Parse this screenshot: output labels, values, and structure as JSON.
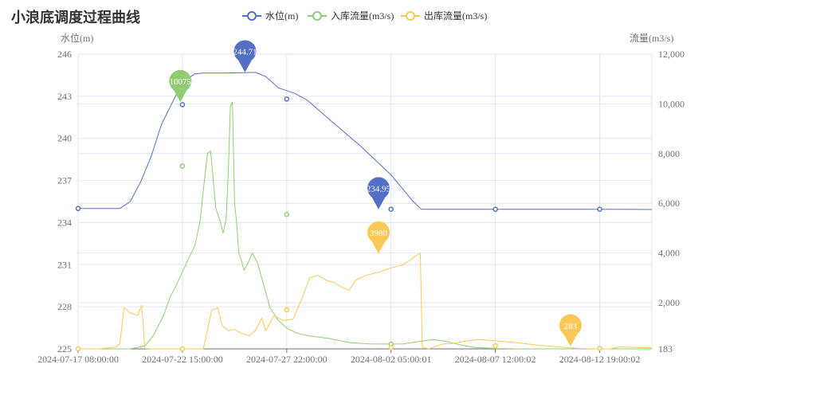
{
  "title": "小浪底调度过程曲线",
  "chart_data": {
    "type": "line",
    "title": "小浪底调度过程曲线",
    "y_left_label": "水位(m)",
    "y_right_label": "流量(m3/s)",
    "x_ticks": [
      "2024-07-17 08:00:00",
      "2024-07-22 15:00:00",
      "2024-07-27 22:00:00",
      "2024-08-02 05:00:01",
      "2024-08-07 12:00:02",
      "2024-08-12 19:00:02"
    ],
    "y_left": {
      "min": 225,
      "max": 246,
      "ticks": [
        225,
        228,
        231,
        234,
        237,
        240,
        243,
        246
      ]
    },
    "y_right": {
      "ticks": [
        183,
        2000,
        4000,
        6000,
        8000,
        10000,
        12000
      ],
      "tick_labels": [
        "183",
        "2,000",
        "4,000",
        "6,000",
        "8,000",
        "10,000",
        "12,000"
      ]
    },
    "legend_position": "top-center",
    "grid": true,
    "series": [
      {
        "name": "水位(m)",
        "axis": "left",
        "color": "#5470c6",
        "points": [
          [
            0,
            235
          ],
          [
            1,
            235
          ],
          [
            2,
            235
          ],
          [
            2.5,
            235.5
          ],
          [
            3,
            236.9
          ],
          [
            3.5,
            238.7
          ],
          [
            4,
            241
          ],
          [
            4.6,
            242.8
          ],
          [
            5,
            244
          ],
          [
            5.6,
            244.6
          ],
          [
            6,
            244.65
          ],
          [
            7,
            244.65
          ],
          [
            8.5,
            244.7
          ],
          [
            9,
            244.4
          ],
          [
            9.6,
            243.6
          ],
          [
            10.4,
            243.2
          ],
          [
            11,
            242.7
          ],
          [
            12,
            241.4
          ],
          [
            13.5,
            239.5
          ],
          [
            15,
            237.4
          ],
          [
            16,
            235.6
          ],
          [
            16.45,
            234.95
          ],
          [
            17,
            234.95
          ],
          [
            18,
            234.95
          ],
          [
            19,
            234.95
          ],
          [
            20,
            234.95
          ],
          [
            25,
            234.95
          ],
          [
            27.5,
            234.93
          ]
        ],
        "markers": [
          [
            0,
            235
          ],
          [
            5,
            242.4
          ],
          [
            10,
            242.8
          ],
          [
            15,
            234.95
          ],
          [
            20,
            234.95
          ],
          [
            25,
            234.95
          ]
        ],
        "pin": {
          "x": 8,
          "y": 244.71,
          "label": "244.71"
        },
        "pin2": {
          "x": 14.4,
          "y": 234.95,
          "label": "234.95"
        }
      },
      {
        "name": "入库流量(m3/s)",
        "axis": "right",
        "color": "#91cc75",
        "points": [
          [
            0,
            183
          ],
          [
            1,
            183
          ],
          [
            2,
            183
          ],
          [
            2.5,
            183
          ],
          [
            3.2,
            300
          ],
          [
            3.6,
            700
          ],
          [
            4.1,
            1500
          ],
          [
            4.4,
            2200
          ],
          [
            4.7,
            2700
          ],
          [
            5.2,
            3600
          ],
          [
            5.6,
            4300
          ],
          [
            5.85,
            5300
          ],
          [
            6.0,
            6500
          ],
          [
            6.2,
            8000
          ],
          [
            6.35,
            8100
          ],
          [
            6.6,
            5800
          ],
          [
            6.8,
            5300
          ],
          [
            6.95,
            4800
          ],
          [
            7.1,
            5400
          ],
          [
            7.2,
            7300
          ],
          [
            7.3,
            9900
          ],
          [
            7.4,
            10075
          ],
          [
            7.5,
            6000
          ],
          [
            7.6,
            5200
          ],
          [
            7.7,
            4000
          ],
          [
            7.8,
            3800
          ],
          [
            7.95,
            3300
          ],
          [
            8.15,
            3600
          ],
          [
            8.35,
            4000
          ],
          [
            8.6,
            3600
          ],
          [
            8.9,
            2700
          ],
          [
            9.2,
            1800
          ],
          [
            9.6,
            1300
          ],
          [
            10.0,
            1000
          ],
          [
            10.5,
            800
          ],
          [
            11,
            700
          ],
          [
            12,
            600
          ],
          [
            13,
            430
          ],
          [
            14,
            380
          ],
          [
            15,
            370
          ],
          [
            15.6,
            380
          ],
          [
            16.4,
            480
          ],
          [
            17,
            550
          ],
          [
            17.6,
            480
          ],
          [
            18.4,
            330
          ],
          [
            19,
            240
          ],
          [
            20,
            200
          ],
          [
            21,
            183
          ],
          [
            27.5,
            183
          ]
        ],
        "markers": [
          [
            5,
            7500
          ],
          [
            10,
            5550
          ],
          [
            15,
            370
          ]
        ],
        "pin": {
          "x": 4.9,
          "y": 10075,
          "label": "10075"
        }
      },
      {
        "name": "出库流量(m3/s)",
        "axis": "right",
        "color": "#fac858",
        "points": [
          [
            0,
            183
          ],
          [
            1,
            183
          ],
          [
            1.8,
            250
          ],
          [
            2.0,
            380
          ],
          [
            2.2,
            1800
          ],
          [
            2.5,
            1600
          ],
          [
            2.85,
            1500
          ],
          [
            3.05,
            1900
          ],
          [
            3.2,
            200
          ],
          [
            3.5,
            183
          ],
          [
            4,
            183
          ],
          [
            5,
            183
          ],
          [
            6,
            183
          ],
          [
            6.4,
            1700
          ],
          [
            6.7,
            1800
          ],
          [
            6.9,
            1100
          ],
          [
            7.2,
            900
          ],
          [
            7.5,
            950
          ],
          [
            7.8,
            800
          ],
          [
            8.2,
            700
          ],
          [
            8.5,
            900
          ],
          [
            8.8,
            1400
          ],
          [
            9.0,
            900
          ],
          [
            9.4,
            1500
          ],
          [
            9.8,
            1300
          ],
          [
            10.3,
            1350
          ],
          [
            10.7,
            2100
          ],
          [
            11.1,
            3000
          ],
          [
            11.5,
            3100
          ],
          [
            11.9,
            2900
          ],
          [
            12.3,
            2800
          ],
          [
            12.7,
            2600
          ],
          [
            13.0,
            2500
          ],
          [
            13.3,
            2900
          ],
          [
            13.8,
            3100
          ],
          [
            14.5,
            3250
          ],
          [
            15.0,
            3400
          ],
          [
            15.5,
            3500
          ],
          [
            15.9,
            3700
          ],
          [
            16.2,
            3900
          ],
          [
            16.4,
            3980
          ],
          [
            16.5,
            250
          ],
          [
            16.8,
            183
          ],
          [
            17.5,
            380
          ],
          [
            18,
            400
          ],
          [
            18.5,
            480
          ],
          [
            19.2,
            550
          ],
          [
            20,
            500
          ],
          [
            21,
            430
          ],
          [
            22,
            330
          ],
          [
            23,
            260
          ],
          [
            24,
            200
          ],
          [
            24.8,
            183
          ],
          [
            25.5,
            183
          ],
          [
            26,
            260
          ],
          [
            27,
            230
          ],
          [
            27.5,
            220
          ]
        ],
        "markers": [
          [
            0,
            183
          ],
          [
            5,
            183
          ],
          [
            10,
            1720
          ],
          [
            15,
            230
          ],
          [
            20,
            310
          ],
          [
            25,
            200
          ]
        ],
        "pin": {
          "x": 14.4,
          "y": 3980,
          "label": "3980"
        },
        "pin2": {
          "x": 23.6,
          "y": 283,
          "label": "283"
        }
      }
    ]
  }
}
